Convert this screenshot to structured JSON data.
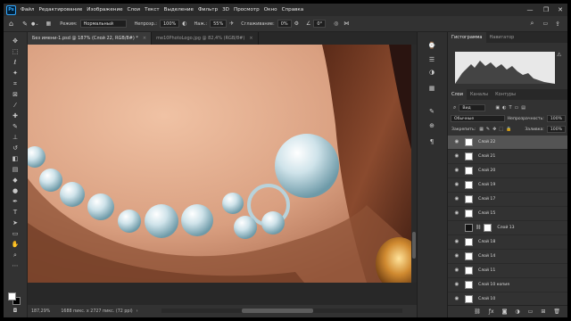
{
  "app": {
    "logo": "Ps"
  },
  "menu": [
    "Файл",
    "Редактирование",
    "Изображение",
    "Слои",
    "Текст",
    "Выделение",
    "Фильтр",
    "3D",
    "Просмотр",
    "Окно",
    "Справка"
  ],
  "window_controls": [
    "—",
    "❐",
    "✕"
  ],
  "options": {
    "mode_label": "Режим:",
    "mode_value": "Нормальный",
    "opacity_label": "Непрозр.:",
    "opacity_value": "100%",
    "pressure_label": "Наж.:",
    "pressure_value": "55%",
    "smoothing_label": "Сглаживание:",
    "smoothing_value": "0%",
    "angle_value": "0°"
  },
  "tabs": [
    {
      "label": "Без имени-1.psd @ 187% (Слой 22, RGB/8#) *",
      "close": "×"
    },
    {
      "label": "me10PhotoLogo.jpg @ 82,4% (RGB/8#)",
      "close": "×"
    }
  ],
  "status": {
    "zoom": "187,29%",
    "info": "1688 пикс. x 2727 пикс. (72 ppi)",
    "arrow": "›"
  },
  "panel_tabs": {
    "histogram": "Гистограмма",
    "navigator": "Навигатор"
  },
  "layers_tabs": {
    "layers": "Слои",
    "channels": "Каналы",
    "paths": "Контуры"
  },
  "layers_controls": {
    "kind": "Вид",
    "blend": "Обычные",
    "opacity_label": "Непрозрачность:",
    "opacity_value": "100%",
    "lock_label": "Закрепить:",
    "fill_label": "Заливка:",
    "fill_value": "100%"
  },
  "layers": [
    "Слой 22",
    "Слой 21",
    "Слой 20",
    "Слой 19",
    "Слой 17",
    "Слой 15",
    "Слой 13",
    "Слой 18",
    "Слой 14",
    "Слой 11",
    "Слой 10 копия",
    "Слой 10"
  ],
  "icons": {
    "tools": [
      "move-icon",
      "marquee-icon",
      "lasso-icon",
      "quick-select-icon",
      "crop-icon",
      "frame-icon",
      "eyedropper-icon",
      "healing-icon",
      "brush-icon",
      "stamp-icon",
      "history-brush-icon",
      "eraser-icon",
      "gradient-icon",
      "blur-icon",
      "dodge-icon",
      "pen-icon",
      "type-icon",
      "path-select-icon",
      "shape-icon",
      "hand-icon",
      "zoom-icon",
      "more-icon"
    ],
    "panel_bottom": [
      "link-icon",
      "fx-icon",
      "mask-icon",
      "adjustment-icon",
      "group-icon",
      "new-layer-icon",
      "delete-icon"
    ]
  }
}
